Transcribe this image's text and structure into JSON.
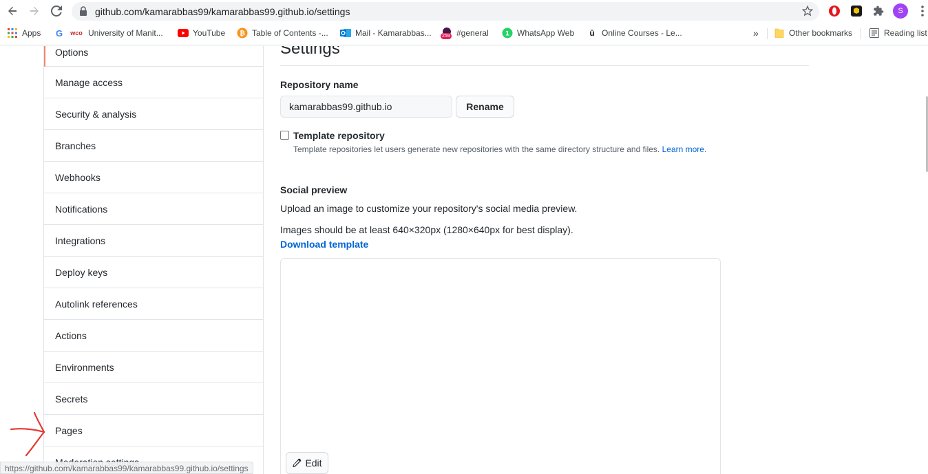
{
  "browser": {
    "url": "github.com/kamarabbas99/kamarabbas99.github.io/settings",
    "profile_initial": "S",
    "status_url": "https://github.com/kamarabbas99/kamarabbas99.github.io/settings",
    "bookmarks": [
      {
        "label": "Apps",
        "icon": "apps-grid-icon"
      },
      {
        "label": "University of Manit...",
        "icon": "google-icon"
      },
      {
        "label": "YouTube",
        "icon": "youtube-icon"
      },
      {
        "label": "Table of Contents -...",
        "icon": "bitcoin-icon"
      },
      {
        "label": "Mail - Kamarabbas...",
        "icon": "outlook-icon"
      },
      {
        "label": "#general",
        "icon": "slack-badge-icon"
      },
      {
        "label": "WhatsApp Web",
        "icon": "whatsapp-icon"
      },
      {
        "label": "Online Courses - Le...",
        "icon": "udemy-icon"
      }
    ],
    "more_label": "»",
    "other_bookmarks": "Other bookmarks",
    "reading_list": "Reading list",
    "badge_count": "259",
    "wco_label": "wco",
    "whatsapp_badge": "1"
  },
  "sidebar": {
    "items": [
      {
        "label": "Options",
        "selected": true
      },
      {
        "label": "Manage access"
      },
      {
        "label": "Security & analysis"
      },
      {
        "label": "Branches"
      },
      {
        "label": "Webhooks"
      },
      {
        "label": "Notifications"
      },
      {
        "label": "Integrations"
      },
      {
        "label": "Deploy keys"
      },
      {
        "label": "Autolink references"
      },
      {
        "label": "Actions"
      },
      {
        "label": "Environments"
      },
      {
        "label": "Secrets"
      },
      {
        "label": "Pages"
      },
      {
        "label": "Moderation settings"
      }
    ]
  },
  "main": {
    "title": "Settings",
    "repo_name_label": "Repository name",
    "repo_name_value": "kamarabbas99.github.io",
    "rename_label": "Rename",
    "template_label": "Template repository",
    "template_note": "Template repositories let users generate new repositories with the same directory structure and files.",
    "learn_more": "Learn more.",
    "social_preview_label": "Social preview",
    "social_preview_desc": "Upload an image to customize your repository's social media preview.",
    "social_preview_size": "Images should be at least 640×320px (1280×640px for best display).",
    "download_template": "Download template",
    "edit_label": "Edit"
  },
  "colors": {
    "accent_link": "#0366d6",
    "selected_marker": "#f9826c",
    "annotation_arrow": "#e53935"
  }
}
